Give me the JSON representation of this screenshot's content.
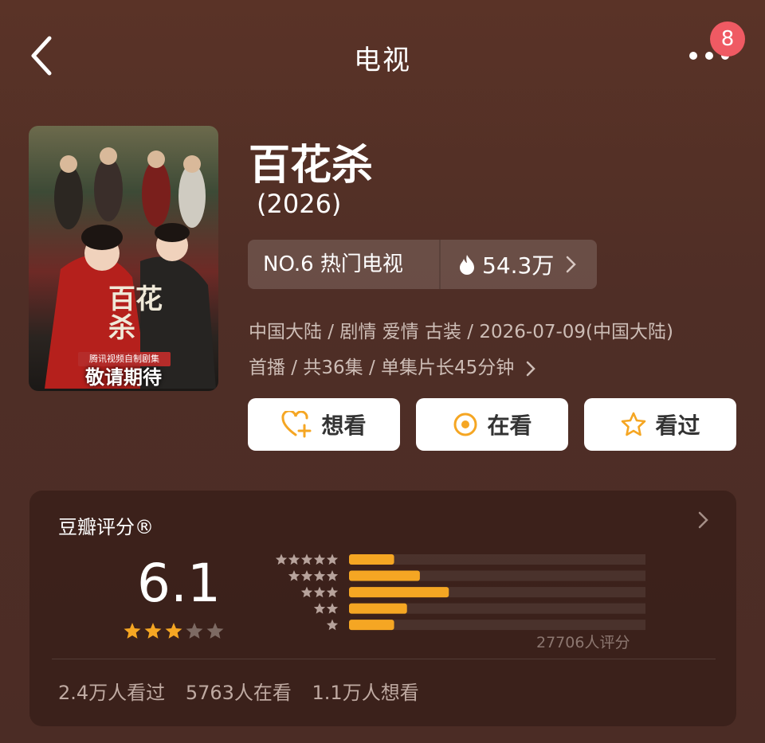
{
  "header": {
    "title": "电视",
    "badge": "8"
  },
  "poster": {
    "banner_text": "腾讯视频自制剧集",
    "cta": "敬请期待",
    "calligraphy": "百花杀"
  },
  "show": {
    "title": "百花杀",
    "year": "(2026)",
    "rank_label": "NO.6 热门电视",
    "heat": "54.3万",
    "meta_line1": "中国大陆 / 剧情 爱情 古装 / 2026-07-09(中国大陆)",
    "meta_line2": "首播 / 共36集 / 单集片长45分钟"
  },
  "actions": {
    "want": "想看",
    "watching": "在看",
    "watched": "看过"
  },
  "rating": {
    "label": "豆瓣评分®",
    "score": "6.1",
    "star_level": 3,
    "count": "27706人评分",
    "distribution": [
      {
        "stars": 5,
        "fraction": 0.14
      },
      {
        "stars": 4,
        "fraction": 0.22
      },
      {
        "stars": 3,
        "fraction": 0.31
      },
      {
        "stars": 2,
        "fraction": 0.18
      },
      {
        "stars": 1,
        "fraction": 0.14
      }
    ],
    "stats": {
      "watched": "2.4万人看过",
      "watching": "5763人在看",
      "want": "1.1万人想看"
    }
  },
  "colors": {
    "accent": "#f5a623",
    "badge": "#ef5a63"
  }
}
